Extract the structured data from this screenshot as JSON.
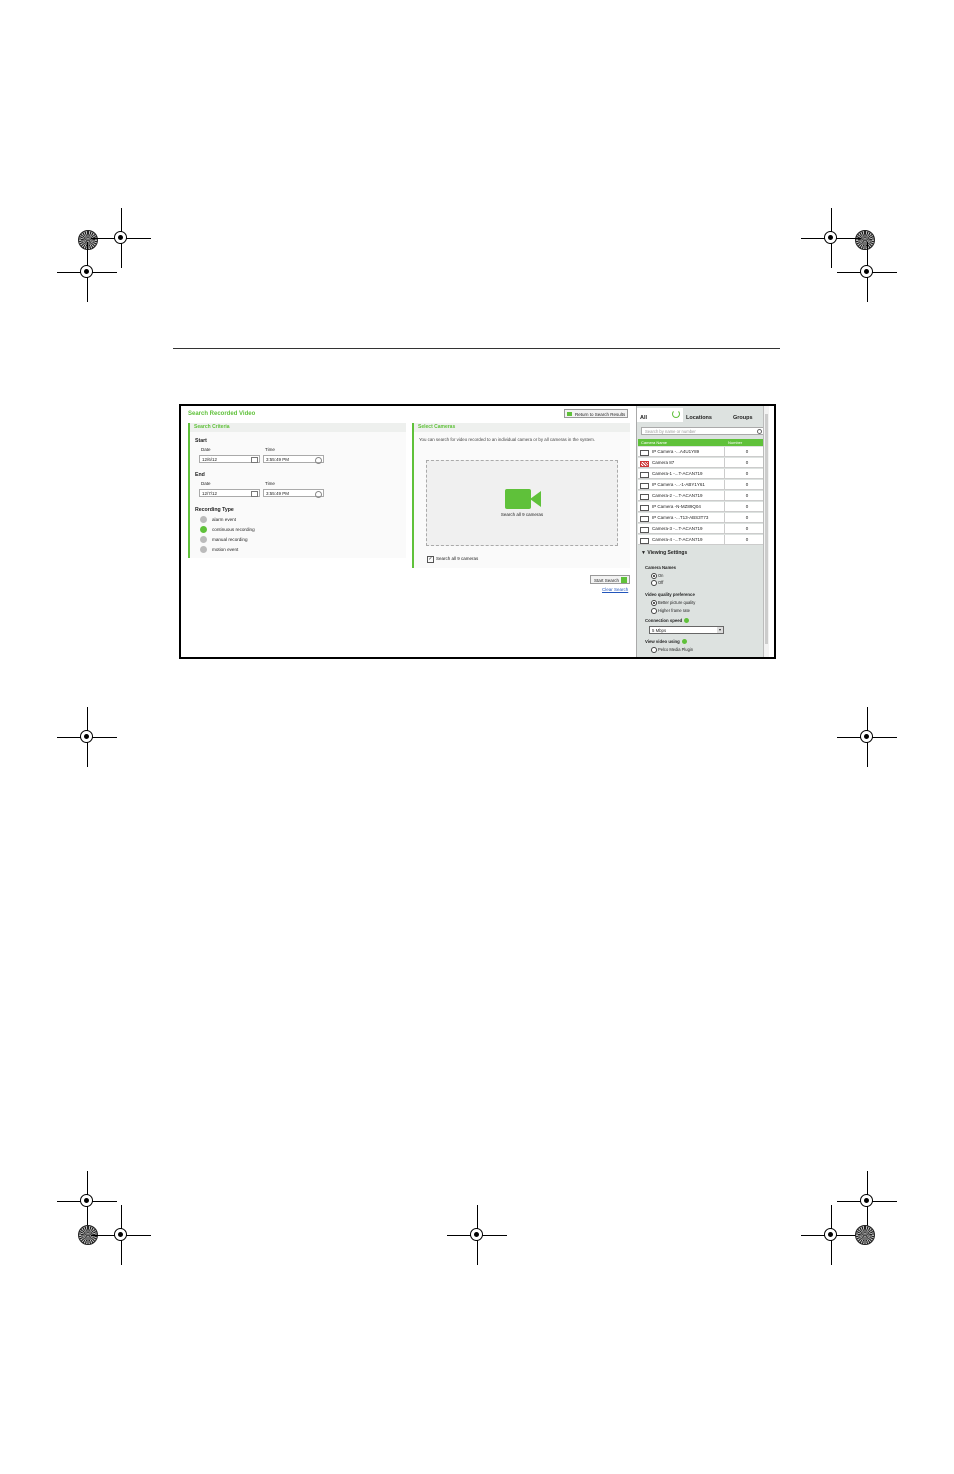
{
  "app": {
    "title": "Search Recorded Video",
    "return_button": "Return to Search Results"
  },
  "criteria": {
    "header": "Search Criteria",
    "start_label": "Start",
    "end_label": "End",
    "date_label": "Date",
    "time_label": "Time",
    "start_date": "12/6/12",
    "start_time": "3:55:49 PM",
    "end_date": "12/7/12",
    "end_time": "3:55:49 PM",
    "recording_type_label": "Recording Type",
    "recording_types": [
      "alarm event",
      "continuous recording",
      "manual recording",
      "motion event"
    ]
  },
  "cameras": {
    "header": "Select Cameras",
    "description": "You can search for video recorded to an individual camera or by all cameras in the system.",
    "drop_label": "Search all 9 cameras",
    "checkbox_label": "Search all 9 cameras",
    "checkbox_mark": "✓",
    "start_search": "Start Search",
    "clear_search": "Clear Search"
  },
  "sidebar": {
    "tabs": [
      "All",
      "Locations",
      "Groups"
    ],
    "search_placeholder": "Search by name or number",
    "col_name": "Camera Name",
    "col_number": "Number",
    "cameras": [
      {
        "name": "IP Camera -...A4U1Y89",
        "number": "0"
      },
      {
        "name": "Camera 87",
        "number": "0"
      },
      {
        "name": "Camera-1 -...T-ACAN719",
        "number": "0"
      },
      {
        "name": "IP Camera -...-1-ABY1Y61",
        "number": "0"
      },
      {
        "name": "Camera-2 -...T-ACAN719",
        "number": "0"
      },
      {
        "name": "IP Camera -N-MZ89Q04",
        "number": "0"
      },
      {
        "name": "IP Camera -...T13-ABS3T73",
        "number": "0"
      },
      {
        "name": "Camera-3 -...T-ACAN719",
        "number": "0"
      },
      {
        "name": "Camera-4 -...T-ACAN719",
        "number": "0"
      }
    ],
    "viewing_settings": "Viewing Settings",
    "camera_names_label": "Camera Names",
    "camera_names_opts": [
      "On",
      "Off"
    ],
    "video_quality_label": "Video quality preference",
    "video_quality_opts": [
      "Better picture quality",
      "Higher frame rate"
    ],
    "connection_speed_label": "Connection speed",
    "connection_speed_value": "5 Mbps",
    "view_video_label": "View video using",
    "view_video_opt": "Pelco Media Plugin",
    "collapse_glyph": "▼",
    "dropdown_glyph": "▾"
  }
}
